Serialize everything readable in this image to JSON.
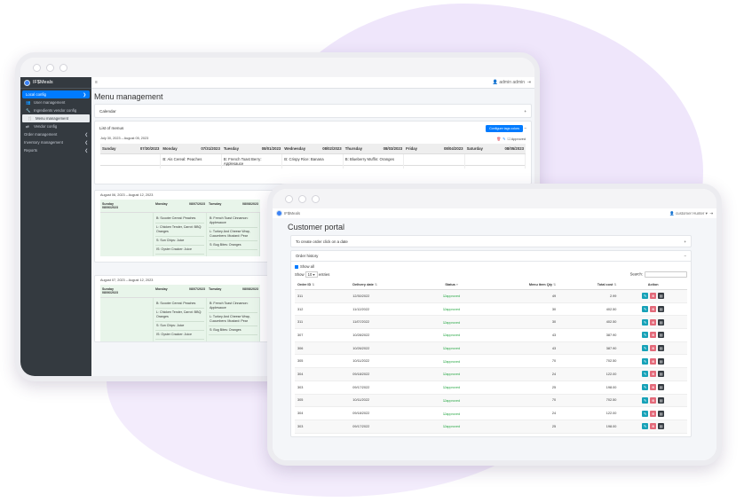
{
  "admin": {
    "brand": "IF$Meals",
    "topbar": {
      "user": "admin admin",
      "menu_icon": "hamburger-icon",
      "logout_icon": "logout-icon"
    },
    "sidebar": {
      "items": [
        {
          "label": "Local config",
          "caret": "❯"
        },
        {
          "label": "User management"
        },
        {
          "label": "Ingredients vendor config"
        },
        {
          "label": "Menu management"
        },
        {
          "label": "Vendor config"
        },
        {
          "label": "Order management",
          "caret": "❮"
        },
        {
          "label": "Inventory management",
          "caret": "❮"
        },
        {
          "label": "Reports",
          "caret": "❮"
        }
      ]
    },
    "title": "Menu management",
    "calendar_label": "Calendar",
    "calendar_toggle": "+",
    "menus_label": "List of menus",
    "configure_btn": "Configure tags colors",
    "menus_toggle": "−",
    "approved_label": "Approved",
    "week1": {
      "range": "July 30, 2023 – August 05, 2023",
      "days": [
        {
          "name": "Sunday",
          "date": "07/30/2023"
        },
        {
          "name": "Monday",
          "date": "07/31/2023"
        },
        {
          "name": "Tuesday",
          "date": "08/01/2023"
        },
        {
          "name": "Wednesday",
          "date": "08/02/2023"
        },
        {
          "name": "Thursday",
          "date": "08/03/2023"
        },
        {
          "name": "Friday",
          "date": "08/04/2023"
        },
        {
          "name": "Saturday",
          "date": "08/05/2023"
        }
      ],
      "meals": [
        "",
        "B: Ais Cereal: Peaches",
        "B: French Toast Berry: Applesauce",
        "B: Crispy Rice: Banana",
        "B: Blueberry Muffin: Oranges",
        "",
        ""
      ]
    },
    "week2": {
      "range": "August 06, 2023 – August 12, 2023",
      "days": [
        {
          "name": "Sunday",
          "date": "08/06/2023"
        },
        {
          "name": "Monday",
          "date": "08/07/2023"
        },
        {
          "name": "Tuesday",
          "date": "08/08/2023"
        }
      ],
      "monday": [
        "B: Scooter Cereal: Peaches",
        "L: Chicken Tender, Carrot: BBQ: Oranges",
        "S: Sun Chips: Juice",
        "IS: Oyster Cracker: Juice"
      ],
      "tuesday": [
        "B: French Toast Cinnamon: Applesauce",
        "L: Turkey And Cheese Wrap, Cucumbers: Mustard: Pear",
        "S: Bug Bites: Oranges"
      ]
    },
    "week3": {
      "range": "August 07, 2023 – August 12, 2023",
      "days": [
        {
          "name": "Sunday",
          "date": "08/06/2023"
        },
        {
          "name": "Monday",
          "date": "08/07/2023"
        },
        {
          "name": "Tuesday",
          "date": "08/08/2023"
        }
      ],
      "monday": [
        "B: Scooter Cereal: Peaches",
        "L: Chicken Tender, Carrot: BBQ: Oranges",
        "S: Sun Chips: Juice",
        "IS: Oyster Cracker: Juice"
      ],
      "tuesday": [
        "B: French Toast Cinnamon: Applesauce",
        "L: Turkey And Cheese Wrap, Cucumbers: Mustard: Pear",
        "S: Bug Bites: Oranges"
      ]
    }
  },
  "portal": {
    "brand": "IF$Meals",
    "user": "customer Hunter",
    "title": "Customer portal",
    "create_order": "To create order click on a date",
    "create_toggle": "+",
    "history_label": "Order history",
    "history_toggle": "−",
    "show_all": "Show all",
    "show": "Show",
    "entries_count": "10",
    "entries": "entries",
    "search_label": "Search:",
    "columns": [
      "Order ID",
      "Delivery date",
      "Status",
      "Menu item Qty",
      "Total cost",
      "Action"
    ],
    "rows": [
      {
        "id": "311",
        "date": "12/30/2022",
        "status": "approved",
        "qty": "49",
        "cost": "2.99"
      },
      {
        "id": "312",
        "date": "11/12/2022",
        "status": "approved",
        "qty": "30",
        "cost": "402.50"
      },
      {
        "id": "311",
        "date": "11/07/2022",
        "status": "approved",
        "qty": "30",
        "cost": "402.50"
      },
      {
        "id": "307",
        "date": "10/28/2022",
        "status": "approved",
        "qty": "43",
        "cost": "387.90"
      },
      {
        "id": "306",
        "date": "10/26/2022",
        "status": "approved",
        "qty": "43",
        "cost": "387.90"
      },
      {
        "id": "305",
        "date": "10/11/2022",
        "status": "approved",
        "qty": "70",
        "cost": "702.50"
      },
      {
        "id": "304",
        "date": "09/18/2022",
        "status": "approved",
        "qty": "24",
        "cost": "122.00"
      },
      {
        "id": "303",
        "date": "09/17/2022",
        "status": "approved",
        "qty": "25",
        "cost": "198.00"
      },
      {
        "id": "305",
        "date": "10/11/2022",
        "status": "approved",
        "qty": "70",
        "cost": "702.50"
      },
      {
        "id": "304",
        "date": "09/18/2022",
        "status": "approved",
        "qty": "24",
        "cost": "122.00"
      },
      {
        "id": "303",
        "date": "09/17/2022",
        "status": "approved",
        "qty": "25",
        "cost": "198.00"
      }
    ],
    "colors": {
      "accent": "#007bff",
      "approved": "#28a745",
      "edit": "#17a2b8",
      "delete": "#e36a7a",
      "print": "#343a40"
    }
  }
}
